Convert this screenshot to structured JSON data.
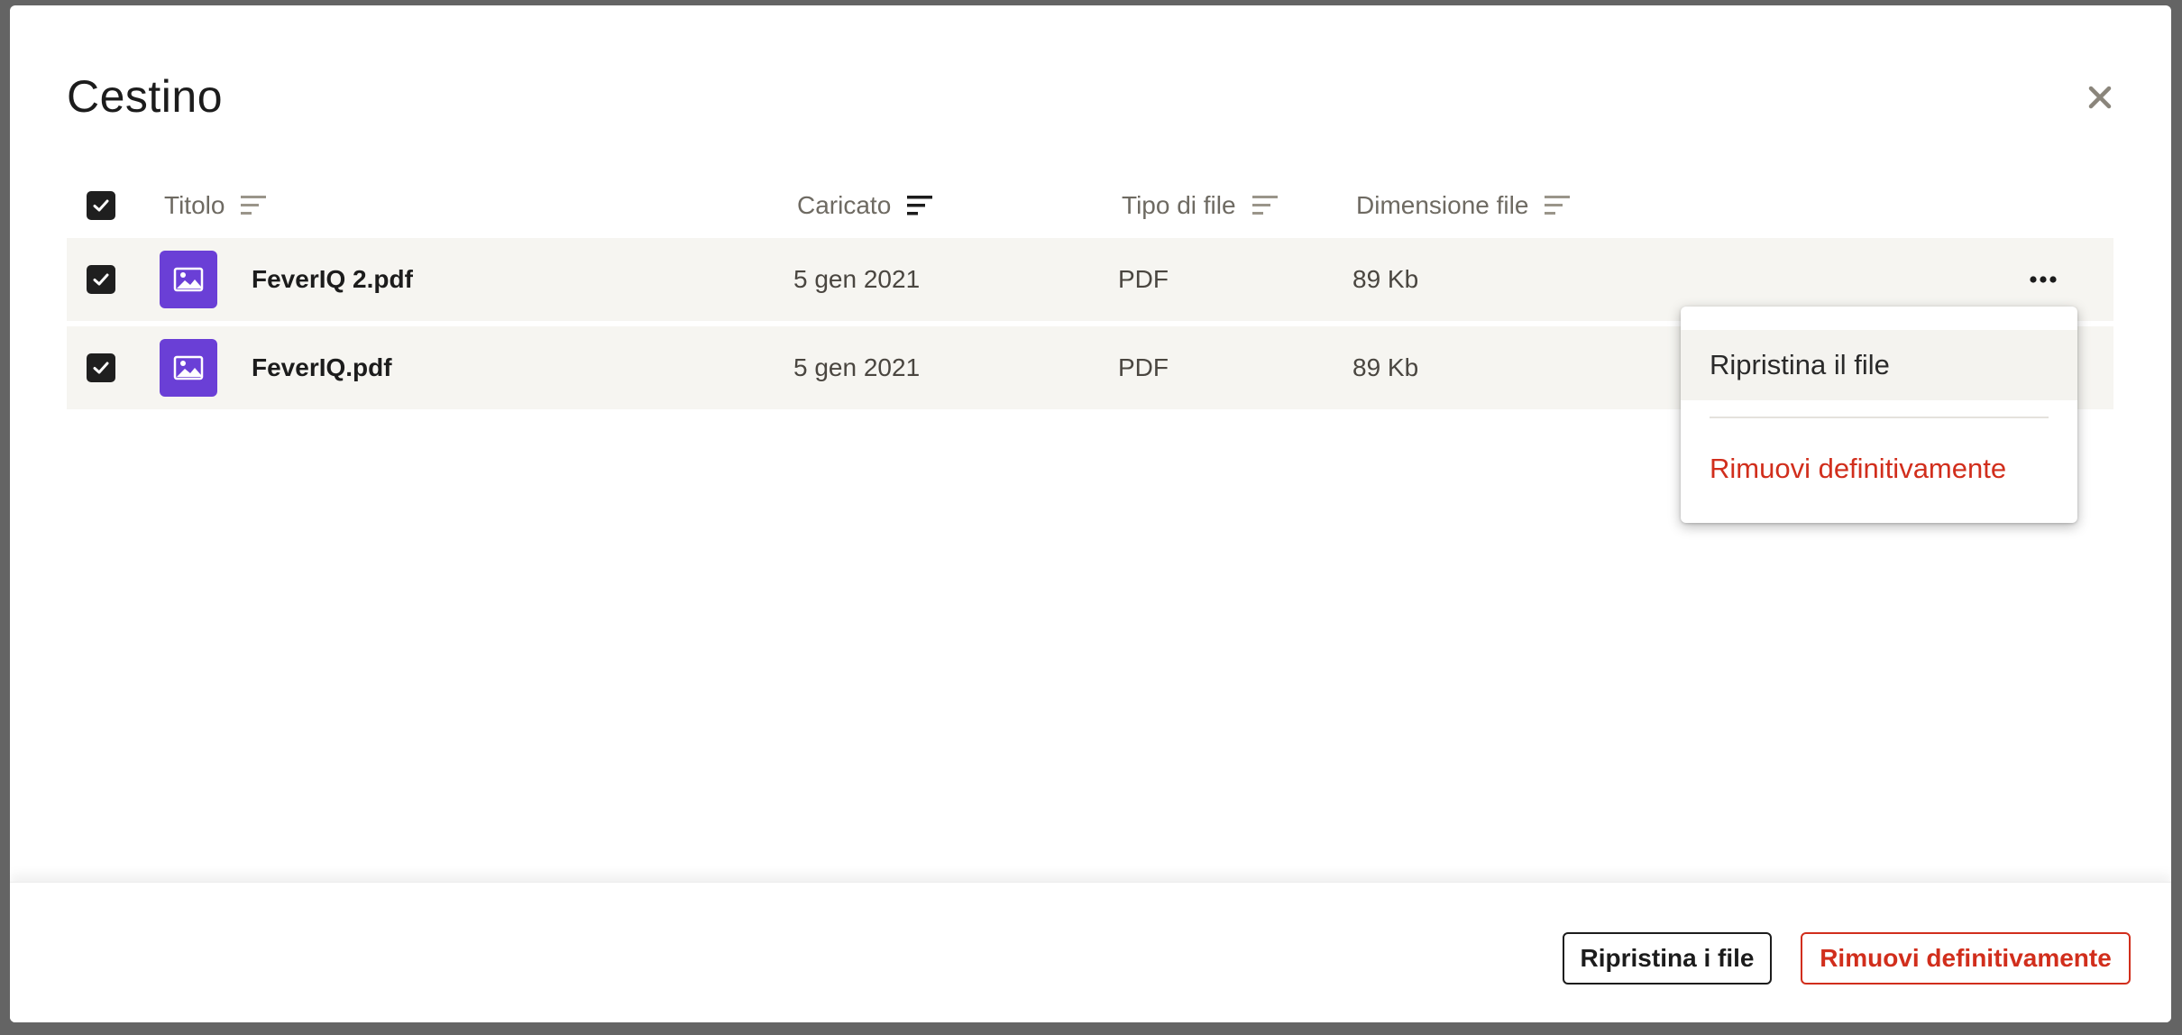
{
  "modal": {
    "title": "Cestino"
  },
  "table": {
    "columns": [
      {
        "label": "Titolo"
      },
      {
        "label": "Caricato"
      },
      {
        "label": "Tipo di file"
      },
      {
        "label": "Dimensione file"
      }
    ],
    "rows": [
      {
        "name": "FeverIQ 2.pdf",
        "uploaded": "5 gen 2021",
        "type": "PDF",
        "size": "89 Kb",
        "checked": true
      },
      {
        "name": "FeverIQ.pdf",
        "uploaded": "5 gen 2021",
        "type": "PDF",
        "size": "89 Kb",
        "checked": true
      }
    ],
    "active_sort_column": "Caricato"
  },
  "dropdown": {
    "restore_label": "Ripristina il file",
    "remove_label": "Rimuovi definitivamente"
  },
  "footer": {
    "restore_button": "Ripristina i file",
    "remove_button": "Rimuovi definitivamente"
  },
  "colors": {
    "accent_purple": "#6a3fd6",
    "danger_red": "#d12e1c",
    "row_background": "#f6f5f1",
    "text_dark": "#1c1c1c"
  },
  "icons": [
    "close-icon",
    "sort-icon",
    "checkbox-checked-icon",
    "image-file-icon",
    "more-horizontal-icon"
  ]
}
